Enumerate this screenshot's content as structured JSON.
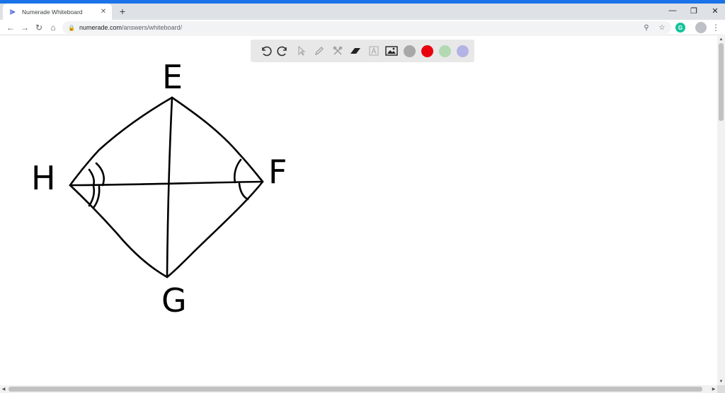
{
  "browser": {
    "tab_title": "Numerade Whiteboard",
    "url_host": "numerade.com",
    "url_path": "/answers/whiteboard/",
    "accent": "#1a73e8"
  },
  "toolbar": {
    "tools": [
      "undo-icon",
      "redo-icon",
      "pointer-icon",
      "pen-icon",
      "tools-icon",
      "eraser-icon",
      "text-icon",
      "image-icon"
    ],
    "colors": [
      "#a8a8a8",
      "#e8000f",
      "#b3d9b3",
      "#b3b3e6"
    ]
  },
  "whiteboard": {
    "labels": {
      "E": "E",
      "F": "F",
      "G": "G",
      "H": "H"
    }
  }
}
